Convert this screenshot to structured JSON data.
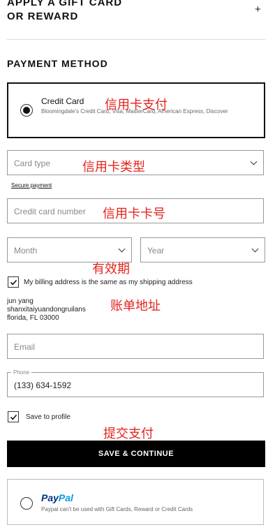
{
  "gift": {
    "title_line1": "APPLY A GIFT CARD",
    "title_line2": "OR REWARD",
    "expand_symbol": "+"
  },
  "payment": {
    "section_title": "PAYMENT METHOD",
    "credit_card": {
      "label": "Credit Card",
      "description": "Bloomingdale's Credit Card, Visa, MasterCard, American Express, Discover",
      "selected": true
    },
    "card_type_placeholder": "Card type",
    "secure_payment_link": "Secure payment",
    "card_number_placeholder": "Credit card number",
    "month_placeholder": "Month",
    "year_placeholder": "Year",
    "billing_same_label": "My billing address is the same as my shipping address",
    "billing_same_checked": true,
    "address": {
      "name": "jun yang",
      "street": "shanxitaiyuandongruilans",
      "city_line": "florida, FL 03000"
    },
    "email_placeholder": "Email",
    "phone_label": "Phone",
    "phone_value": "(133) 634-1592",
    "save_profile_label": "Save to profile",
    "save_profile_checked": true,
    "submit_label": "SAVE & CONTINUE",
    "paypal": {
      "logo_pay": "Pay",
      "logo_pal": "Pal",
      "description": "Paypal can't be used with Gift Cards, Reward or Credit Cards",
      "selected": false
    }
  },
  "annotations": {
    "credit_card_payment": "信用卡支付",
    "card_type": "信用卡类型",
    "card_number": "信用卡卡号",
    "expiry": "有效期",
    "billing_address": "账单地址",
    "submit_payment": "提交支付"
  },
  "colors": {
    "annotation_red": "#e3231d",
    "button_black": "#000000",
    "paypal_dark_blue": "#003087",
    "paypal_light_blue": "#009cde"
  }
}
